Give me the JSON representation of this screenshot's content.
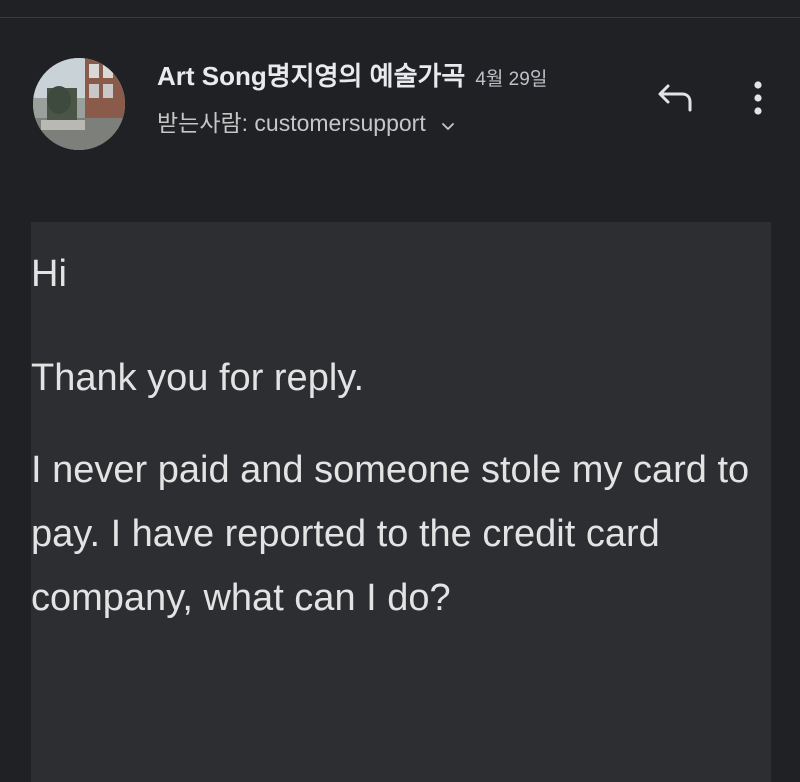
{
  "email": {
    "sender": {
      "name": "Art Song명지영의 예술가곡",
      "date": "4월 29일"
    },
    "recipient": {
      "label": "받는사람: customersupport"
    },
    "body": {
      "greeting": "Hi",
      "line1": "Thank you for reply.",
      "line2": "I never paid and someone stole my card to pay. I have reported to the credit card company, what can I do?"
    }
  },
  "icons": {
    "reply": "reply-icon",
    "more": "more-vert-icon",
    "chevron": "chevron-down-icon"
  },
  "colors": {
    "background": "#1f2124",
    "card": "#2d2e31",
    "text": "#e3e3e3"
  }
}
